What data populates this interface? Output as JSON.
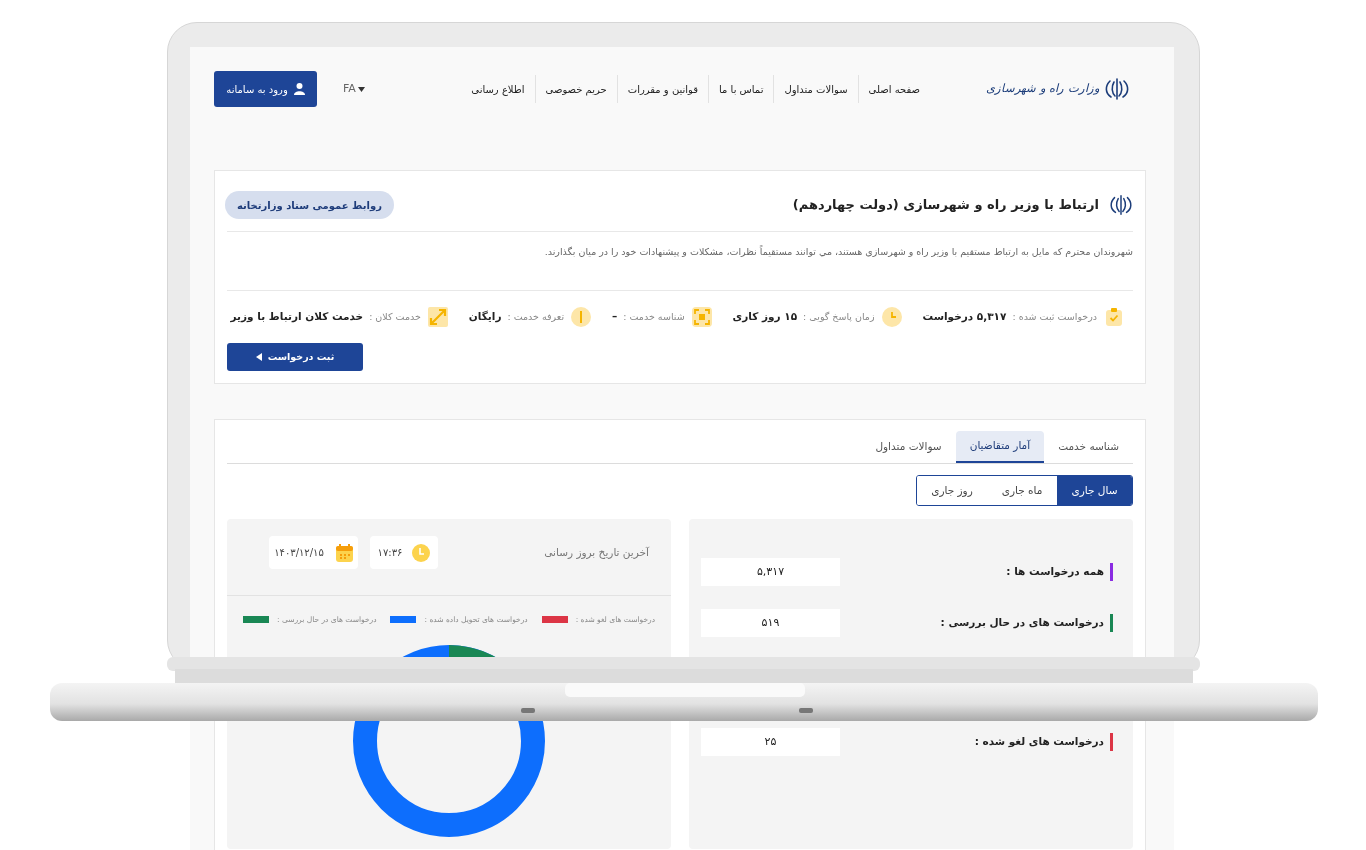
{
  "header": {
    "logo_text": "وزارت راه و شهرسازی",
    "nav": [
      "صفحه اصلی",
      "سوالات متداول",
      "تماس با ما",
      "قوانین و مقررات",
      "حریم خصوصی",
      "اطلاع رسانی"
    ],
    "language": "FA",
    "login_button": "ورود به سامانه"
  },
  "service": {
    "title": "ارتباط با وزیر راه و شهرسازی (دولت چهاردهم)",
    "department": "روابط عمومی ستاد وزارتخانه",
    "description": "شهروندان محترم که مایل به ارتباط مستقیم با وزیر راه و شهرسازی هستند، مي توانند مستقیماً نظرات، مشکلات و پیشنهادات خود را در میان بگذارند.",
    "info": [
      {
        "label": "درخواست ثبت شده :",
        "value": "۵,۳۱۷ درخواست"
      },
      {
        "label": "زمان پاسخ گویی :",
        "value": "۱۵ روز کاری"
      },
      {
        "label": "شناسه خدمت :",
        "value": "–"
      },
      {
        "label": "تعرفه خدمت :",
        "value": "رایگان"
      },
      {
        "label": "خدمت کلان :",
        "value": "خدمت کلان ارتباط با وزیر"
      }
    ],
    "submit_button": "ثبت درخواست"
  },
  "tabs": [
    {
      "label": "شناسه خدمت",
      "selected": false
    },
    {
      "label": "آمار متقاضیان",
      "selected": true
    },
    {
      "label": "سوالات متداول",
      "selected": false
    }
  ],
  "periods": [
    {
      "label": "سال جاری",
      "selected": true
    },
    {
      "label": "ماه جاری",
      "selected": false
    },
    {
      "label": "روز جاری",
      "selected": false
    }
  ],
  "stats": [
    {
      "label": "همه درخواست ها :",
      "value": "۵,۳۱۷",
      "color": "#8a2be2"
    },
    {
      "label": "درخواست های در حال بررسی :",
      "value": "۵۱۹",
      "color": "#198754"
    },
    {
      "label": "درخواست های لغو شده :",
      "value": "۲۵",
      "color": "#dc3545"
    }
  ],
  "update": {
    "title": "آخرین تاریخ بروز رسانی",
    "time": "۱۷:۳۶",
    "date": "۱۴۰۳/۱۲/۱۵"
  },
  "legend": [
    {
      "label": "درخواست های لغو شده :",
      "color": "#dc3545"
    },
    {
      "label": "درخواست های تحویل داده شده :",
      "color": "#0d6efd"
    },
    {
      "label": "درخواست های در حال بررسی :",
      "color": "#198754"
    }
  ]
}
